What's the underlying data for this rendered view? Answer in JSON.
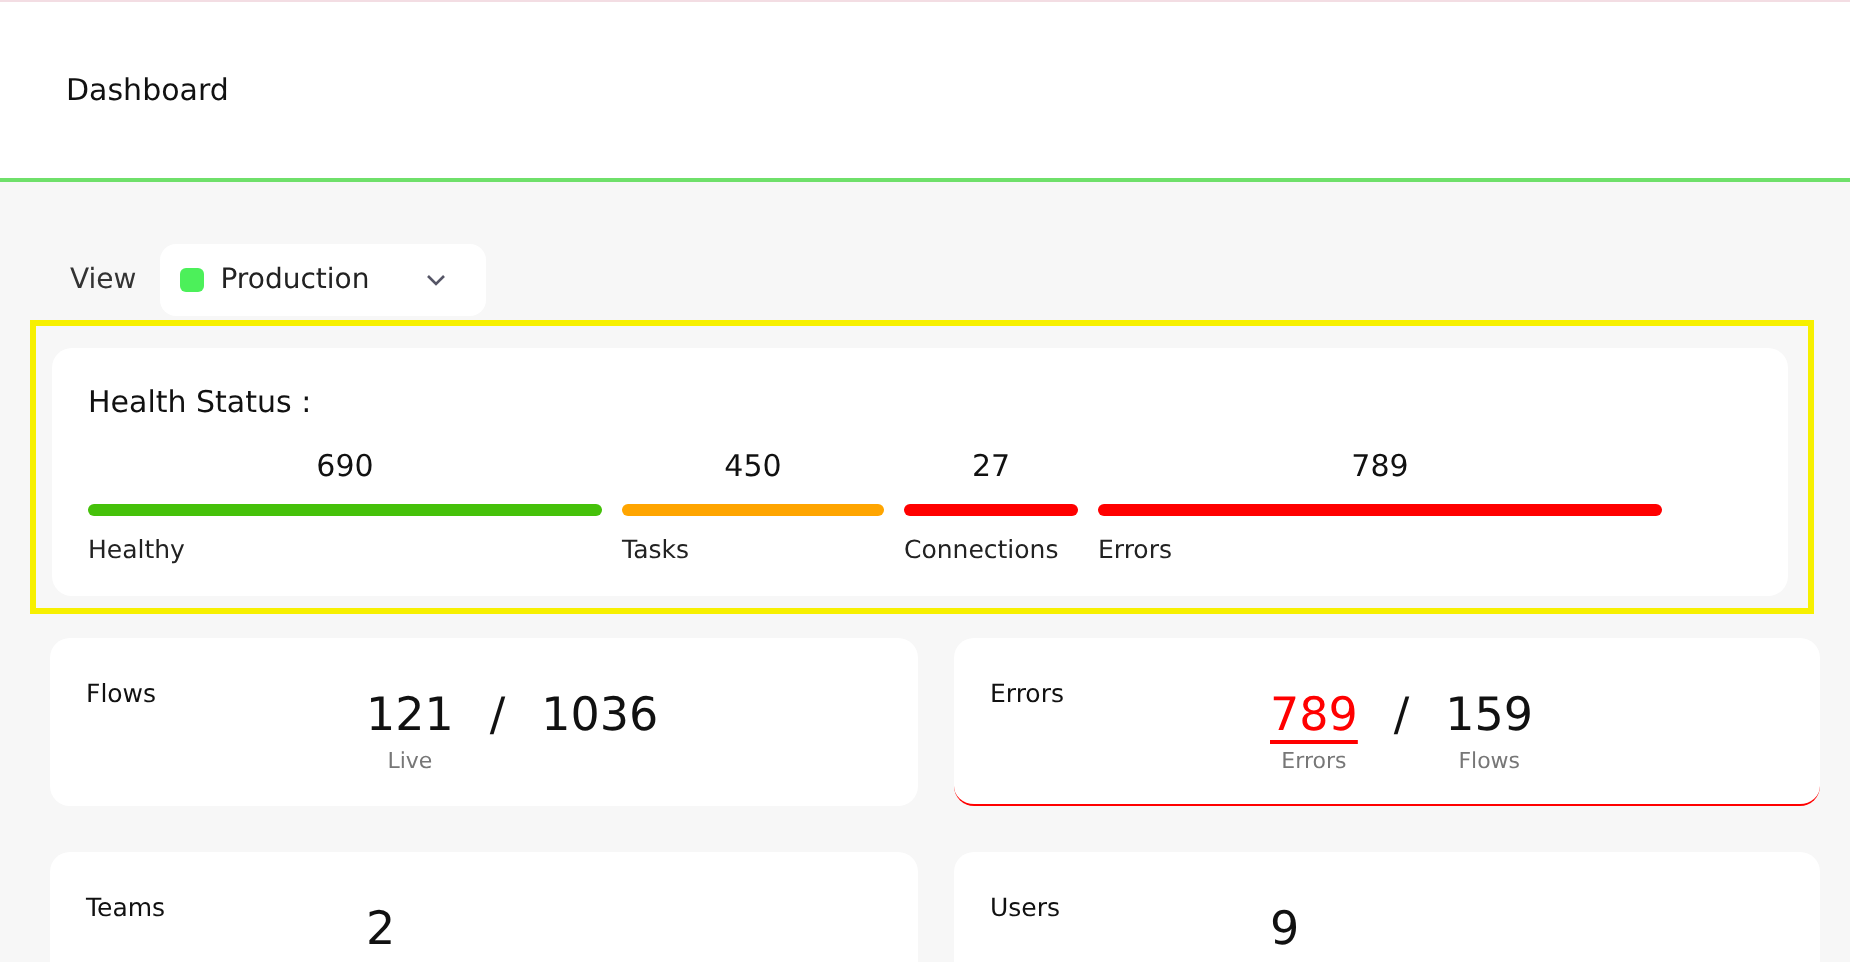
{
  "header": {
    "title": "Dashboard"
  },
  "view": {
    "label": "View",
    "selected_option": "Production",
    "color": "#4cf05a"
  },
  "health": {
    "title": "Health Status :",
    "highlighted": true,
    "segments": [
      {
        "name": "Healthy",
        "count": "690",
        "color": "#45c10a"
      },
      {
        "name": "Tasks",
        "count": "450",
        "color": "#ffa500"
      },
      {
        "name": "Connections",
        "count": "27",
        "color": "#ff0000"
      },
      {
        "name": "Errors",
        "count": "789",
        "color": "#ff0000"
      }
    ]
  },
  "cards": [
    {
      "title": "Flows",
      "alert": false,
      "separator": "/",
      "values": [
        {
          "value": "121",
          "caption": "Live",
          "alert": false
        },
        {
          "value": "1036"
        }
      ]
    },
    {
      "title": "Errors",
      "alert": true,
      "separator": "/",
      "values": [
        {
          "value": "789",
          "caption": "Errors",
          "alert": true
        },
        {
          "value": "159",
          "caption": "Flows",
          "alert": false
        }
      ]
    },
    {
      "title": "Teams",
      "values": [
        {
          "value": "2"
        }
      ]
    },
    {
      "title": "Users",
      "values": [
        {
          "value": "9"
        }
      ]
    }
  ]
}
